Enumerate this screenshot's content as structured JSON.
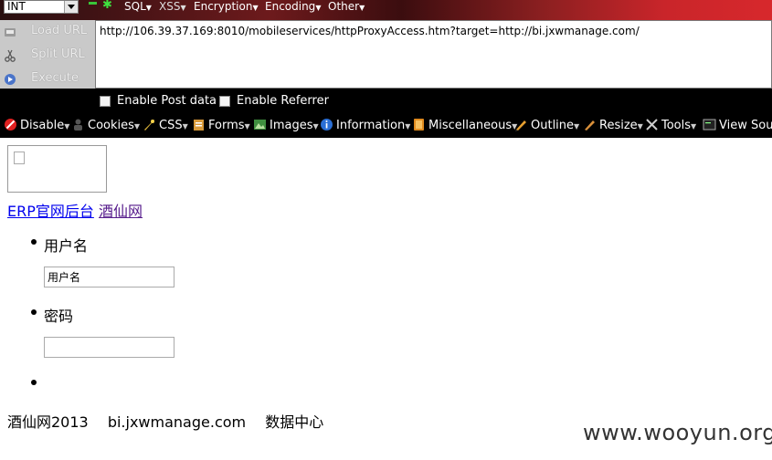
{
  "hackbar": {
    "select_value": "INT",
    "menus": [
      "SQL",
      "XSS",
      "Encryption",
      "Encoding",
      "Other"
    ],
    "left_buttons": [
      {
        "label": "Load URL",
        "icon": "load-url-icon"
      },
      {
        "label": "Split URL",
        "icon": "scissors-icon"
      },
      {
        "label": "Execute",
        "icon": "play-icon"
      }
    ],
    "url": "http://106.39.37.169:8010/mobileservices/httpProxyAccess.htm?target=http://bi.jxwmanage.com/",
    "enable_post": "Enable Post data",
    "enable_referrer": "Enable Referrer"
  },
  "devtoolbar": {
    "items": [
      {
        "label": "Disable",
        "icon": "disable-icon"
      },
      {
        "label": "Cookies",
        "icon": "cookies-icon"
      },
      {
        "label": "CSS",
        "icon": "css-icon"
      },
      {
        "label": "Forms",
        "icon": "forms-icon"
      },
      {
        "label": "Images",
        "icon": "images-icon"
      },
      {
        "label": "Information",
        "icon": "information-icon"
      },
      {
        "label": "Miscellaneous",
        "icon": "miscellaneous-icon"
      },
      {
        "label": "Outline",
        "icon": "outline-icon"
      },
      {
        "label": "Resize",
        "icon": "resize-icon"
      },
      {
        "label": "Tools",
        "icon": "tools-icon"
      },
      {
        "label": "View Sour",
        "icon": "view-source-icon"
      }
    ]
  },
  "page": {
    "links": [
      "ERP官网后台",
      "酒仙网"
    ],
    "username_label": "用户名",
    "username_value": "用户名",
    "password_label": "密码",
    "password_value": "",
    "footer": [
      "酒仙网2013",
      "bi.jxwmanage.com",
      "数据中心"
    ]
  },
  "watermark": "www.wooyun.org",
  "colors": {
    "toolbar_bg": "#000000",
    "link": "#0000ee",
    "visited_link": "#551a8b",
    "header_red": "#d7282c"
  }
}
